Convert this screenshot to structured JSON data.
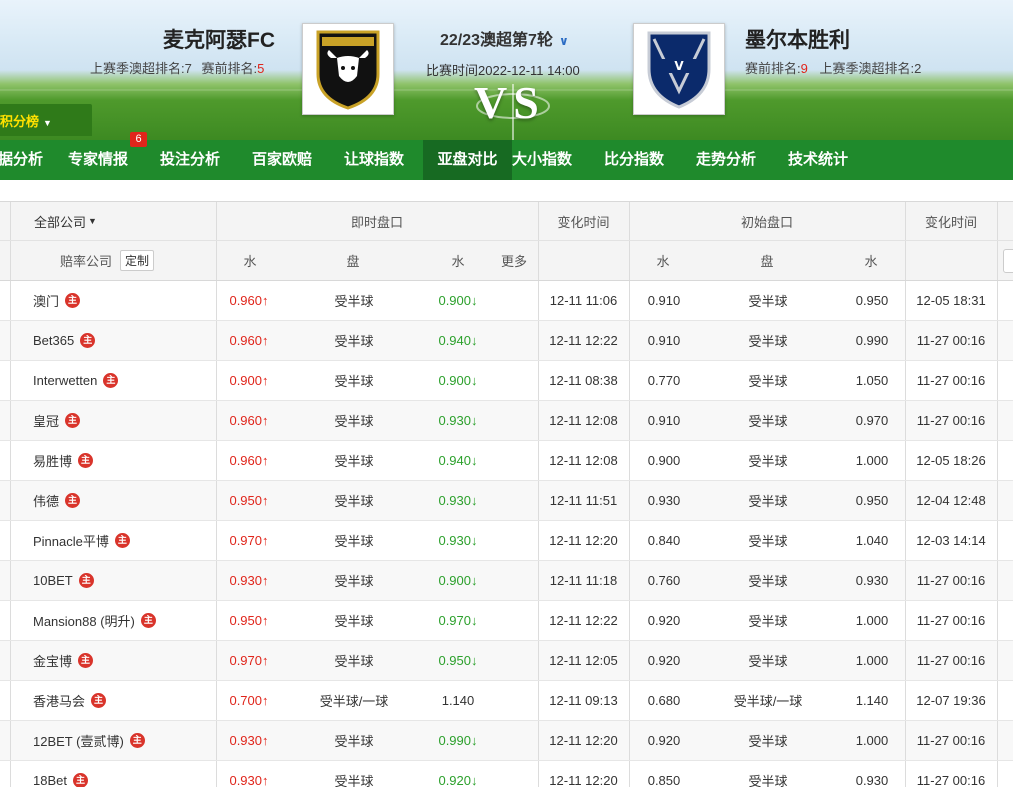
{
  "match": {
    "home_team": "麦克阿瑟FC",
    "home_last_season": "上赛季澳超排名:7",
    "home_pre_label": "赛前排名:",
    "home_pre_value": "5",
    "away_team": "墨尔本胜利",
    "away_pre_label": "赛前排名:",
    "away_pre_value": "9",
    "away_last_season": "上赛季澳超排名:2",
    "round": "22/23澳超第7轮",
    "time": "比赛时间2022-12-11 14:00",
    "vs": "VS"
  },
  "standings_button": "积分榜",
  "nav": {
    "items": [
      "据分析",
      "专家情报",
      "投注分析",
      "百家欧赔",
      "让球指数",
      "亚盘对比",
      "大小指数",
      "比分指数",
      "走势分析",
      "技术统计"
    ],
    "active_index": 5,
    "badge": "6"
  },
  "table": {
    "company_filter": "全部公司",
    "group_live": "即时盘口",
    "group_change_time": "变化时间",
    "group_initial": "初始盘口",
    "group_change_time2": "变化时间",
    "col_company": "赔率公司",
    "custom_btn": "定制",
    "col_water": "水",
    "col_handicap": "盘",
    "col_water2": "水",
    "col_more": "更多",
    "col_init_water": "水",
    "col_init_handicap": "盘",
    "col_init_water2": "水",
    "zhu": "主",
    "rows": [
      {
        "company": "澳门",
        "w1": "0.960",
        "w1d": "up",
        "hc": "受半球",
        "w2": "0.900",
        "w2d": "down",
        "t": "12-11 11:06",
        "iw1": "0.910",
        "ihc": "受半球",
        "iw2": "0.950",
        "it": "12-05 18:31"
      },
      {
        "company": "Bet365",
        "w1": "0.960",
        "w1d": "up",
        "hc": "受半球",
        "w2": "0.940",
        "w2d": "down",
        "t": "12-11 12:22",
        "iw1": "0.910",
        "ihc": "受半球",
        "iw2": "0.990",
        "it": "11-27 00:16"
      },
      {
        "company": "Interwetten",
        "w1": "0.900",
        "w1d": "up",
        "hc": "受半球",
        "w2": "0.900",
        "w2d": "down",
        "t": "12-11 08:38",
        "iw1": "0.770",
        "ihc": "受半球",
        "iw2": "1.050",
        "it": "11-27 00:16"
      },
      {
        "company": "皇冠",
        "w1": "0.960",
        "w1d": "up",
        "hc": "受半球",
        "w2": "0.930",
        "w2d": "down",
        "t": "12-11 12:08",
        "iw1": "0.910",
        "ihc": "受半球",
        "iw2": "0.970",
        "it": "11-27 00:16"
      },
      {
        "company": "易胜博",
        "w1": "0.960",
        "w1d": "up",
        "hc": "受半球",
        "w2": "0.940",
        "w2d": "down",
        "t": "12-11 12:08",
        "iw1": "0.900",
        "ihc": "受半球",
        "iw2": "1.000",
        "it": "12-05 18:26"
      },
      {
        "company": "伟德",
        "w1": "0.950",
        "w1d": "up",
        "hc": "受半球",
        "w2": "0.930",
        "w2d": "down",
        "t": "12-11 11:51",
        "iw1": "0.930",
        "ihc": "受半球",
        "iw2": "0.950",
        "it": "12-04 12:48"
      },
      {
        "company": "Pinnacle平博",
        "w1": "0.970",
        "w1d": "up",
        "hc": "受半球",
        "w2": "0.930",
        "w2d": "down",
        "t": "12-11 12:20",
        "iw1": "0.840",
        "ihc": "受半球",
        "iw2": "1.040",
        "it": "12-03 14:14"
      },
      {
        "company": "10BET",
        "w1": "0.930",
        "w1d": "up",
        "hc": "受半球",
        "w2": "0.900",
        "w2d": "down",
        "t": "12-11 11:18",
        "iw1": "0.760",
        "ihc": "受半球",
        "iw2": "0.930",
        "it": "11-27 00:16"
      },
      {
        "company": "Mansion88 (明升)",
        "w1": "0.950",
        "w1d": "up",
        "hc": "受半球",
        "w2": "0.970",
        "w2d": "down",
        "t": "12-11 12:22",
        "iw1": "0.920",
        "ihc": "受半球",
        "iw2": "1.000",
        "it": "11-27 00:16"
      },
      {
        "company": "金宝博",
        "w1": "0.970",
        "w1d": "up",
        "hc": "受半球",
        "w2": "0.950",
        "w2d": "down",
        "t": "12-11 12:05",
        "iw1": "0.920",
        "ihc": "受半球",
        "iw2": "1.000",
        "it": "11-27 00:16"
      },
      {
        "company": "香港马会",
        "w1": "0.700",
        "w1d": "up",
        "hc": "受半球/一球",
        "w2": "1.140",
        "w2d": "none",
        "t": "12-11 09:13",
        "iw1": "0.680",
        "ihc": "受半球/一球",
        "iw2": "1.140",
        "it": "12-07 19:36"
      },
      {
        "company": "12BET (壹贰博)",
        "w1": "0.930",
        "w1d": "up",
        "hc": "受半球",
        "w2": "0.990",
        "w2d": "down",
        "t": "12-11 12:20",
        "iw1": "0.920",
        "ihc": "受半球",
        "iw2": "1.000",
        "it": "11-27 00:16"
      },
      {
        "company": "18Bet",
        "w1": "0.930",
        "w1d": "up",
        "hc": "受半球",
        "w2": "0.920",
        "w2d": "down",
        "t": "12-11 12:20",
        "iw1": "0.850",
        "ihc": "受半球",
        "iw2": "0.930",
        "it": "11-27 00:16"
      }
    ]
  },
  "colors": {
    "up": "#e0251b",
    "down": "#2ca02c",
    "nav_bg": "#1f8a2c",
    "nav_active": "#176a22"
  },
  "icons": {
    "dropdown": "chevron-down-icon",
    "up": "arrow-up-icon",
    "down": "arrow-down-icon",
    "zhu": "home-badge-icon"
  }
}
